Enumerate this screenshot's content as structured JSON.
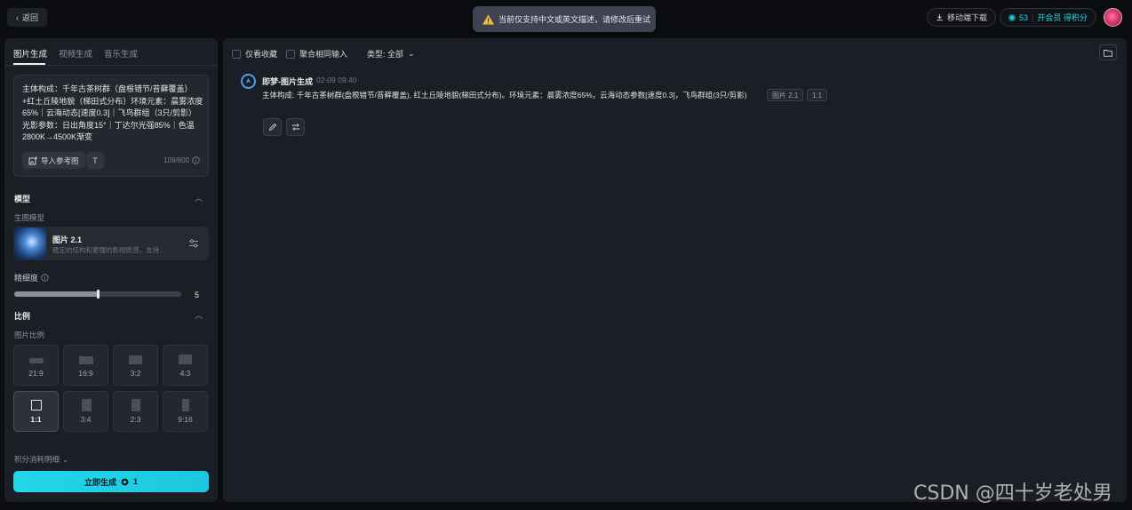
{
  "topbar": {
    "back_label": "返回",
    "toast_text": "当前仅支持中文或英文描述，请修改后重试",
    "download_label": "移动端下载",
    "credits": "53",
    "member_cta": "开会员 得积分"
  },
  "sidebar": {
    "tabs": [
      {
        "label": "图片生成",
        "active": true
      },
      {
        "label": "视频生成",
        "active": false
      },
      {
        "label": "音乐生成",
        "active": false
      }
    ],
    "prompt_text": "主体构成：千年古茶树群（盘根错节/苔藓覆盖）+红土丘陵地貌（梯田式分布）环境元素：晨雾浓度65%｜云海动态[速度0.3]｜飞鸟群组（3只/剪影）光影参数：日出角度15°｜丁达尔光强85%｜色温2800K→4500K渐变",
    "import_ref_label": "导入参考图",
    "text_tool_label": "T",
    "char_count": "109/800",
    "model_section_title": "模型",
    "model_sub_label": "生图模型",
    "model_name": "图片 2.1",
    "model_desc": "稳定的结构和更强的影视质感，支持...",
    "detail_label": "精细度",
    "detail_value": "5",
    "detail_fraction": 0.5,
    "ratio_section_title": "比例",
    "ratio_sub_label": "图片比例",
    "ratios": [
      {
        "label": "21:9",
        "active": false
      },
      {
        "label": "16:9",
        "active": false
      },
      {
        "label": "3:2",
        "active": false
      },
      {
        "label": "4:3",
        "active": false
      },
      {
        "label": "1:1",
        "active": true
      },
      {
        "label": "3:4",
        "active": false
      },
      {
        "label": "2:3",
        "active": false
      },
      {
        "label": "9:16",
        "active": false
      }
    ],
    "cost_detail_label": "积分消耗明细",
    "generate_label": "立即生成",
    "generate_cost": "1"
  },
  "main": {
    "filter_favorites": "仅看收藏",
    "filter_merge": "聚合相同输入",
    "filter_type": "类型: 全部",
    "entry": {
      "source": "即梦-图片生成",
      "time": "02-09  09:40",
      "text": "主体构成: 千年古茶树群(盘根错节/苔藓覆盖), 红土丘陵地貌(梯田式分布)。环境元素：晨雾浓度65%，云海动态参数[速度0.3]，飞鸟群组(3只/剪影)",
      "tag_model": "图片 2.1",
      "tag_ratio": "1:1"
    }
  },
  "watermark": "CSDN @四十岁老处男"
}
